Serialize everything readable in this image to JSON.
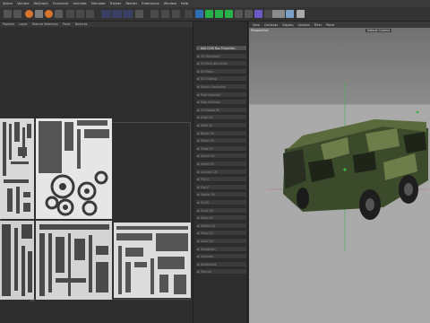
{
  "menubar": [
    "Spline",
    "Volume",
    "MoGraph",
    "Character",
    "Animate",
    "Simulate",
    "Tracker",
    "Render",
    "Extensions",
    "Window",
    "Help"
  ],
  "uv_menubar": [
    "Pipeline",
    "Layer",
    "Texture Selection",
    "Paint",
    "Textures"
  ],
  "uv_bottom_label": "1,0",
  "mid_panel_rows": [
    {
      "label": "Add UVW Box Projection",
      "active": true
    },
    {
      "label": "UV Transform",
      "active": false
    },
    {
      "label": "UV Pack And Scale",
      "active": false
    },
    {
      "label": "UV Relax",
      "active": false
    },
    {
      "label": "UV Unwrap",
      "active": false
    },
    {
      "label": "Select Connected",
      "active": false
    },
    {
      "label": "Pack Selected",
      "active": false
    },
    {
      "label": "Map Selected",
      "active": false
    },
    {
      "label": "UV Rotate 90",
      "active": false
    },
    {
      "label": "Align UV",
      "active": false
    },
    {
      "label": "Weld UV",
      "active": false
    },
    {
      "label": "Break UV",
      "active": false
    },
    {
      "label": "Mirror UV",
      "active": false
    },
    {
      "label": "Grow UV",
      "active": false
    },
    {
      "label": "Shrink UV",
      "active": false
    },
    {
      "label": "Invert UV",
      "active": false
    },
    {
      "label": "Connect UV",
      "active": false
    },
    {
      "label": "Flip U",
      "active": false
    },
    {
      "label": "Flip V",
      "active": false
    },
    {
      "label": "Center UV",
      "active": false
    },
    {
      "label": "Fit UV",
      "active": false
    },
    {
      "label": "Scale UV",
      "active": false
    },
    {
      "label": "Move UV",
      "active": false
    },
    {
      "label": "Rotate UV",
      "active": false
    },
    {
      "label": "Snap UV",
      "active": false
    },
    {
      "label": "Stack UV",
      "active": false
    },
    {
      "label": "Straighten",
      "active": false
    },
    {
      "label": "Optimize",
      "active": false
    },
    {
      "label": "Randomize",
      "active": false
    },
    {
      "label": "Texture",
      "active": false
    }
  ],
  "viewport_menubar": [
    "View",
    "Cameras",
    "Display",
    "Options",
    "Filter",
    "Panel"
  ],
  "viewport_label": "Perspective",
  "viewport_camera": "Default Camera",
  "colors": {
    "accent": "#3d8fd6",
    "toolbar_blue": "#2f6fb6",
    "green": "#2ab24a"
  }
}
